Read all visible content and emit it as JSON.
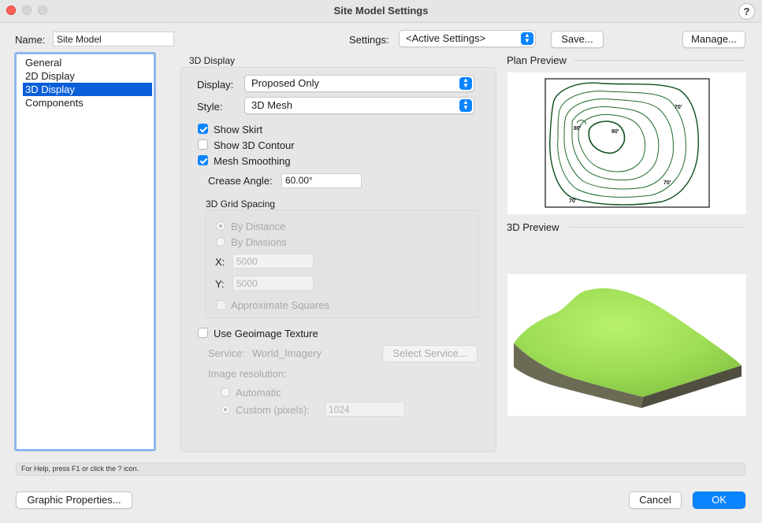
{
  "window": {
    "title": "Site Model Settings",
    "help_label": "?"
  },
  "header": {
    "name_label": "Name:",
    "name_value": "Site Model",
    "settings_label": "Settings:",
    "settings_value": "<Active Settings>",
    "save_label": "Save...",
    "manage_label": "Manage..."
  },
  "sidebar": {
    "items": [
      {
        "label": "General"
      },
      {
        "label": "2D Display"
      },
      {
        "label": "3D Display",
        "selected": true
      },
      {
        "label": "Components"
      }
    ]
  },
  "display3d": {
    "section_title": "3D Display",
    "display_label": "Display:",
    "display_value": "Proposed Only",
    "style_label": "Style:",
    "style_value": "3D Mesh",
    "show_skirt": {
      "label": "Show Skirt",
      "checked": true
    },
    "show_3d_contour": {
      "label": "Show 3D Contour",
      "checked": false
    },
    "mesh_smoothing": {
      "label": "Mesh Smoothing",
      "checked": true
    },
    "crease_angle_label": "Crease Angle:",
    "crease_angle_value": "60.00°",
    "grid": {
      "title": "3D Grid Spacing",
      "by_distance": "By Distance",
      "by_divisions": "By Divisions",
      "x_label": "X:",
      "x_value": "5000",
      "y_label": "Y:",
      "y_value": "5000",
      "approx_squares": "Approximate Squares"
    },
    "geoimage": {
      "label": "Use Geoimage Texture",
      "checked": false,
      "service_label": "Service:",
      "service_value": "World_Imagery",
      "select_service": "Select Service...",
      "image_resolution": "Image resolution:",
      "automatic": "Automatic",
      "custom_label": "Custom (pixels):",
      "custom_value": "1024"
    }
  },
  "previews": {
    "plan_title": "Plan Preview",
    "preview_3d_title": "3D Preview",
    "contour_labels": {
      "a": "70'",
      "b": "80'",
      "c": "80'",
      "d": "70'",
      "e": "70'"
    },
    "terrain_color": "#a7e35a"
  },
  "status": {
    "text": "For Help, press F1 or click the ? icon."
  },
  "footer": {
    "graphic_properties": "Graphic Properties...",
    "cancel": "Cancel",
    "ok": "OK"
  }
}
